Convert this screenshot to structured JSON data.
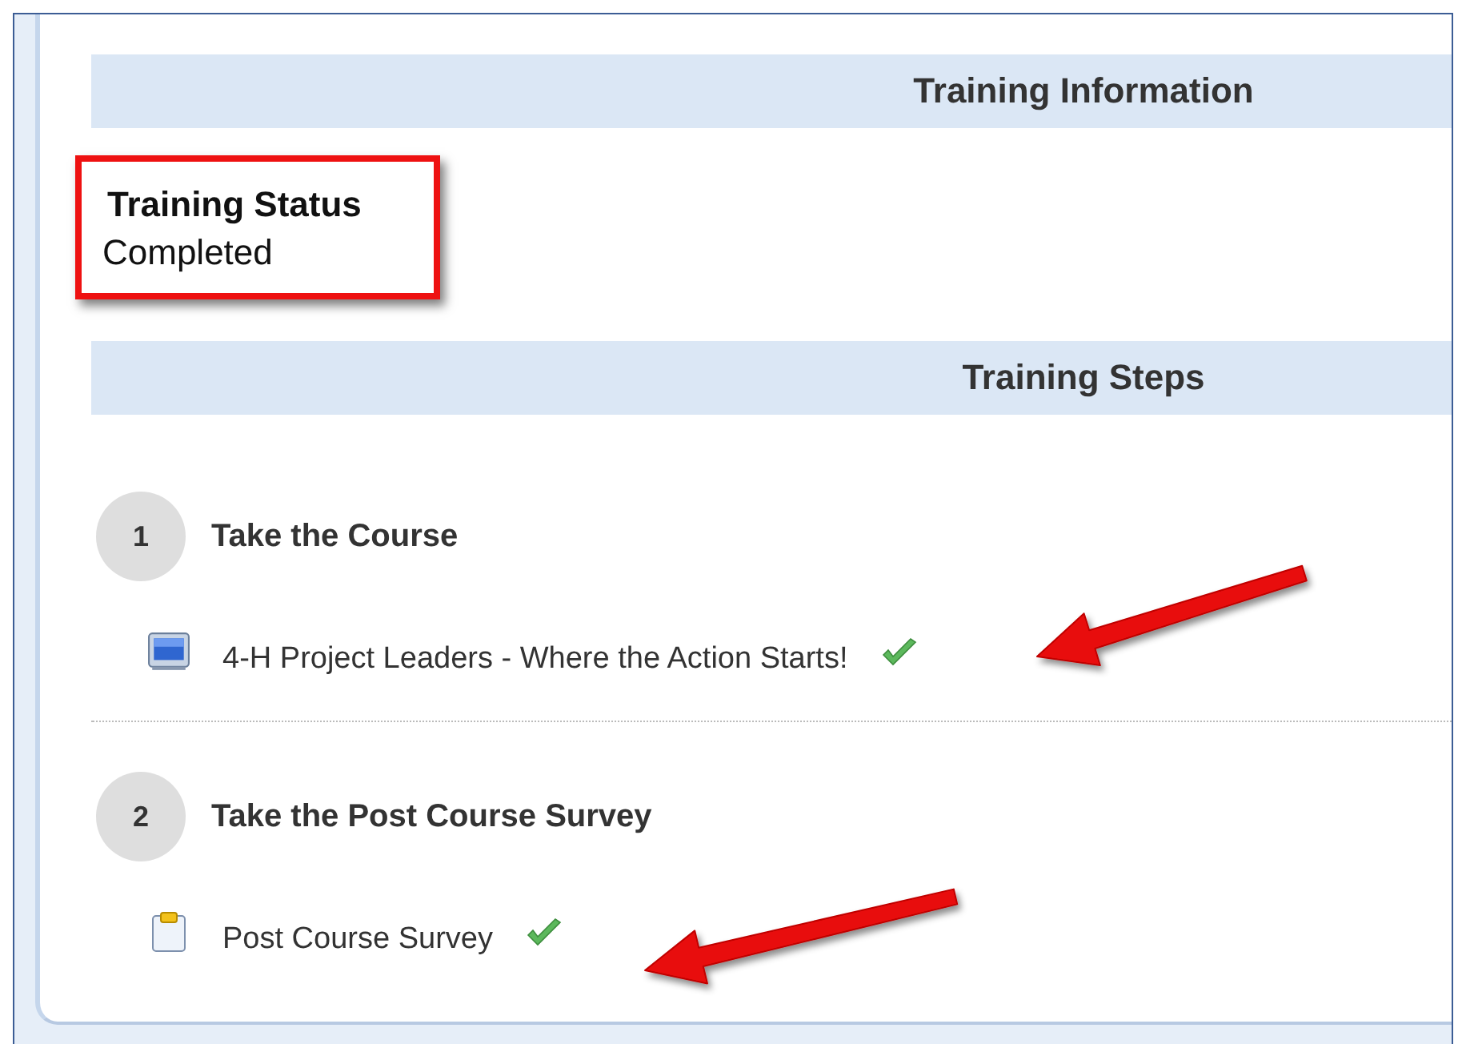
{
  "sections": [
    {
      "title": "Training Information"
    },
    {
      "title": "Training Steps"
    }
  ],
  "status": {
    "label": "Training Status",
    "value": "Completed",
    "highlighted": true
  },
  "steps": [
    {
      "number": "1",
      "title": "Take the Course",
      "items": [
        {
          "kind": "course",
          "label": "4-H Project Leaders - Where the Action Starts!",
          "completed": true,
          "arrow": true
        }
      ]
    },
    {
      "number": "2",
      "title": "Take the Post Course Survey",
      "items": [
        {
          "kind": "survey",
          "label": "Post Course Survey",
          "completed": true,
          "arrow": true
        }
      ]
    }
  ]
}
